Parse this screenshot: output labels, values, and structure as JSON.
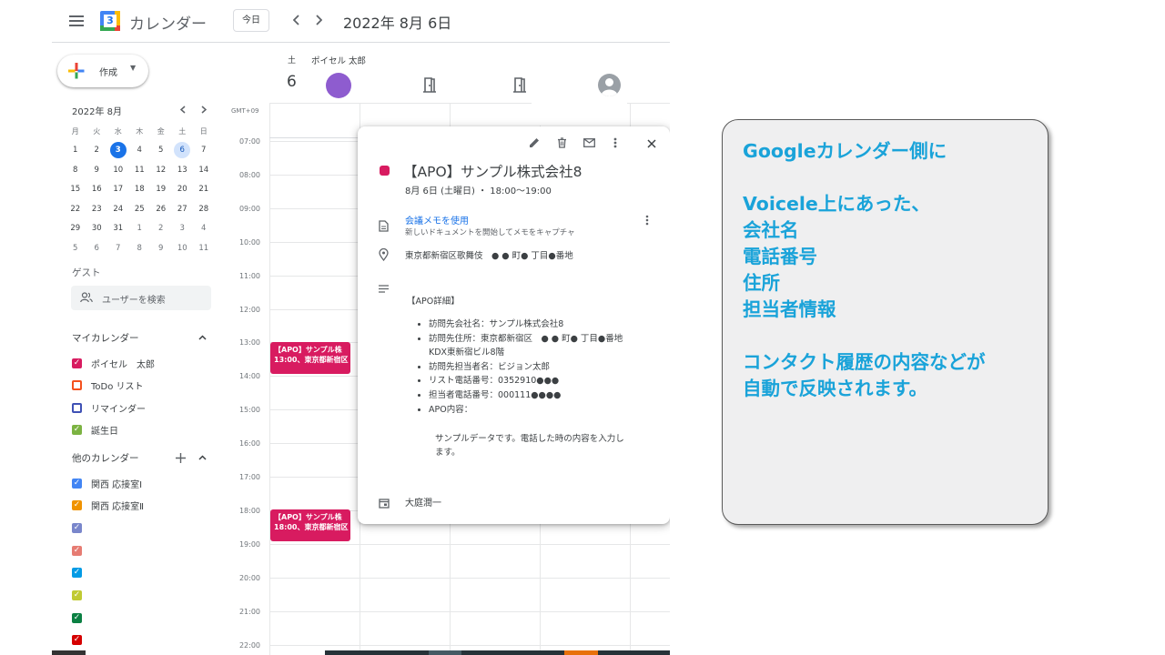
{
  "header": {
    "app_title": "カレンダー",
    "logo_day": "3",
    "today_button": "今日",
    "date_title": "2022年 8月 6日",
    "menu_icon": "hamburger-icon",
    "prev_icon": "chevron-left-icon",
    "next_icon": "chevron-right-icon"
  },
  "sidebar": {
    "create_button": "作成",
    "mini_calendar": {
      "month_label": "2022年 8月",
      "weekdays": [
        "月",
        "火",
        "水",
        "木",
        "金",
        "土",
        "日"
      ],
      "weeks": [
        [
          "1",
          "2",
          "3",
          "4",
          "5",
          "6",
          "7"
        ],
        [
          "8",
          "9",
          "10",
          "11",
          "12",
          "13",
          "14"
        ],
        [
          "15",
          "16",
          "17",
          "18",
          "19",
          "20",
          "21"
        ],
        [
          "22",
          "23",
          "24",
          "25",
          "26",
          "27",
          "28"
        ],
        [
          "29",
          "30",
          "31",
          "1",
          "2",
          "3",
          "4"
        ],
        [
          "5",
          "6",
          "7",
          "8",
          "9",
          "10",
          "11"
        ]
      ],
      "today": "3",
      "selected": "6"
    },
    "guest_heading": "ゲスト",
    "user_search_placeholder": "ユーザーを検索",
    "my_calendars_heading": "マイカレンダー",
    "my_calendars": [
      {
        "label": "ポイセル　太郎",
        "color": "#d81b60",
        "checked": true
      },
      {
        "label": "ToDo リスト",
        "color": "#f4511e",
        "checked": false
      },
      {
        "label": "リマインダー",
        "color": "#3f51b5",
        "checked": false
      },
      {
        "label": "誕生日",
        "color": "#7cb342",
        "checked": true
      }
    ],
    "other_calendars_heading": "他のカレンダー",
    "other_calendars": [
      {
        "label": "関西 応接室Ⅰ",
        "color": "#4285f4"
      },
      {
        "label": "関西 応接室Ⅱ",
        "color": "#f09300"
      },
      {
        "label": "",
        "color": "#7986cb"
      },
      {
        "label": "",
        "color": "#e67c73"
      },
      {
        "label": "",
        "color": "#039be5"
      },
      {
        "label": "",
        "color": "#c0ca33"
      },
      {
        "label": "",
        "color": "#0b8043"
      },
      {
        "label": "",
        "color": "#d50000"
      }
    ]
  },
  "day_view": {
    "day_of_week": "土",
    "day_number": "6",
    "person_name": "ポイセル 太郎",
    "timezone": "GMT+09",
    "time_labels": [
      "07:00",
      "08:00",
      "09:00",
      "10:00",
      "11:00",
      "12:00",
      "13:00",
      "14:00",
      "15:00",
      "16:00",
      "17:00",
      "18:00",
      "19:00",
      "20:00",
      "21:00",
      "22:00"
    ],
    "events": [
      {
        "title": "【APO】サンプル株",
        "detail": "13:00、東京都新宿区"
      },
      {
        "title": "【APO】サンプル株",
        "detail": "18:00、東京都新宿区"
      }
    ]
  },
  "event_popup": {
    "title": "【APO】サンプル株式会社8",
    "datetime": "8月 6日 (土曜日) ・ 18:00～19:00",
    "meeting_notes_link": "会議メモを使用",
    "meeting_notes_sub": "新しいドキュメントを開始してメモをキャプチャ",
    "location": "東京都新宿区歌舞伎　● ● 町● 丁目●番地",
    "details_heading": "【APO詳細】",
    "details": [
      "訪問先会社名：サンプル株式会社8",
      "訪問先住所：東京都新宿区　● ● 町● 丁目●番地",
      "KDX東新宿ビル8階",
      "訪問先担当者名：ビジョン太郎",
      "リスト電話番号：0352910●●●",
      "担当者電話番号：000111●●●●",
      "APO内容："
    ],
    "note_line1": "サンプルデータです。電話した時の内容を入力し",
    "note_line2": "ます。",
    "organizer": "大庭潤一",
    "color": "#d81b60"
  },
  "callout": {
    "lines": [
      "Googleカレンダー側に",
      "",
      "Voicele上にあった、",
      "会社名",
      "電話番号",
      "住所",
      "担当者情報",
      "",
      "コンタクト履歴の内容などが",
      "自動で反映されます。"
    ],
    "text_color": "#1aa3d9"
  }
}
